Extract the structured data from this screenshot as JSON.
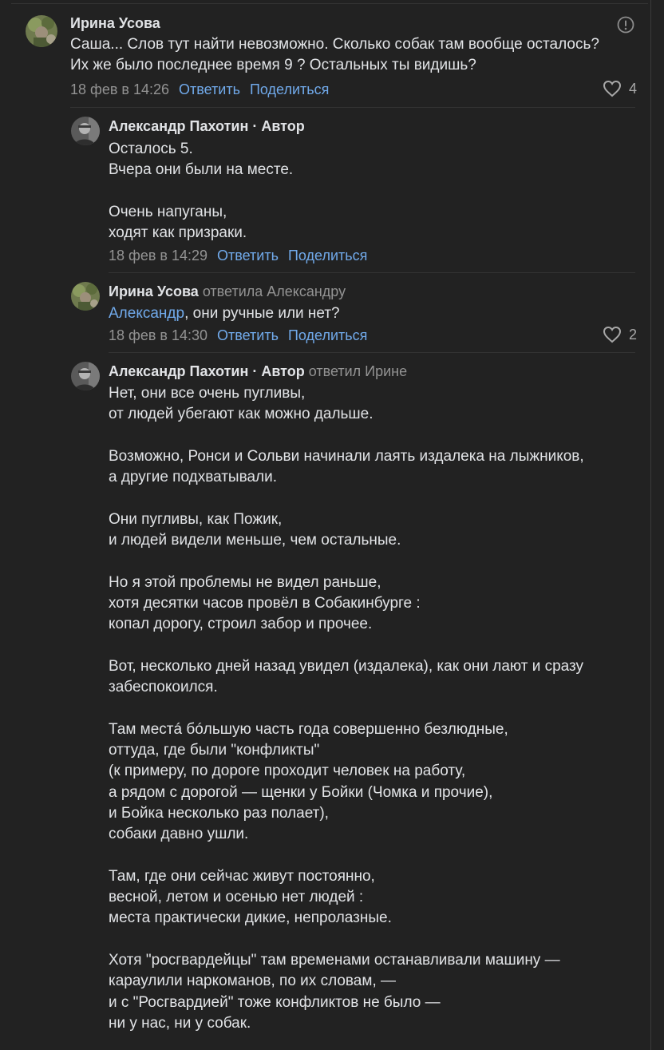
{
  "comments": [
    {
      "author": "Ирина Усова",
      "text": "Саша... Слов тут найти невозможно. Сколько собак там вообще осталось?\nИх же было последнее время 9 ? Остальных ты видишь?",
      "date": "18 фев в 14:26",
      "reply_label": "Ответить",
      "share_label": "Поделиться",
      "likes": "4",
      "report_icon": "report-icon"
    },
    {
      "author": "Александр Пахотин · Автор",
      "text": "Осталось 5.\nВчера они были на месте.\n\nОчень напуганы,\nходят как призраки.",
      "date": "18 фев в 14:29",
      "reply_label": "Ответить",
      "share_label": "Поделиться"
    },
    {
      "author": "Ирина Усова",
      "reply_note": "ответила Александру",
      "mention": "Александр",
      "text": ", они ручные или нет?",
      "date": "18 фев в 14:30",
      "reply_label": "Ответить",
      "share_label": "Поделиться",
      "likes": "2"
    },
    {
      "author": "Александр Пахотин · Автор",
      "reply_note": "ответил Ирине",
      "text": "Нет, они все очень пугливы,\nот людей убегают как можно дальше.\n\nВозможно, Ронси и Сольви начинали лаять издалека на лыжников,\nа другие подхватывали.\n\nОни пугливы, как Пожик,\nи людей видели меньше, чем остальные.\n\nНо я этой проблемы не видел раньше,\nхотя десятки часов провёл в Собакинбурге :\nкопал дорогу, строил забор и прочее.\n\nВот, несколько дней назад увидел (издалека), как они лают и сразу\nзабеспокоился.\n\nТам местá бóльшую часть года совершенно безлюдные,\nоттуда, где были \"конфликты\"\n(к примеру, по дороге проходит человек на работу,\nа рядом с дорогой — щенки у Бойки (Чомка и прочие),\nи Бойка несколько раз полает),\nсобаки давно ушли.\n\nТам, где они сейчас живут постоянно,\nвесной, летом и осенью нет людей :\nместа практически дикие, непролазные.\n\nХотя \"росгвардейцы\" там временами останавливали машину —\nкараулили наркоманов, по их словам, —\nи с \"Росгвардией\" тоже конфликтов не было —\nни у нас, ни у собак."
    }
  ],
  "colors": {
    "background": "#222222",
    "text": "#e1e3e6",
    "muted": "#939393",
    "link": "#71aaeb",
    "divider": "#333333"
  },
  "icons": {
    "like": "heart-icon",
    "report": "report-icon",
    "avatar_irina": "avatar-irina",
    "avatar_alexander": "avatar-alexander"
  }
}
